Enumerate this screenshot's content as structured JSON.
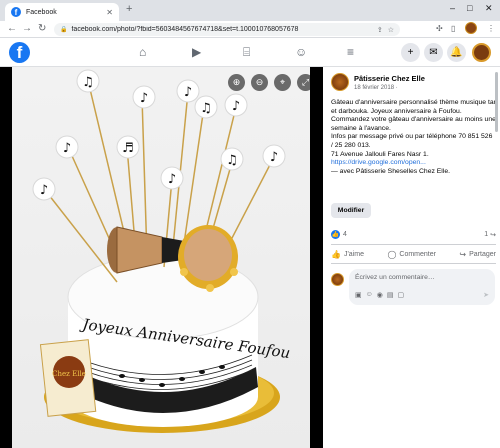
{
  "browser": {
    "tab_title": "Facebook",
    "tab_favicon": "f",
    "url": "facebook.com/photo/?fbid=5603484567674718&set=t.100010768057678"
  },
  "fb_header": {
    "logo": "f"
  },
  "post": {
    "page_name": "Pâtisserie Chez Elle",
    "date": "18 février 2018 ·",
    "text_lines": [
      "Gâteau d'anniversaire personnalisé thème musique tar et darbouka. Joyeux anniversaire à Foufou.",
      "Commandez votre gâteau d'anniversaire au moins une semaine à l'avance.",
      "Infos par message privé ou par téléphone 70 851 526 / 25 280 013.",
      "71 Avenue Jallouli Fares Nasr 1."
    ],
    "link": "https://drive.google.com/open...",
    "tagged": "— avec Pâtisserie Sheselles Chez Elle.",
    "edit_button": "Modifier",
    "like_count": "4",
    "share_count": "1"
  },
  "actions": {
    "like": "J'aime",
    "comment": "Commenter",
    "share": "Partager"
  },
  "comment": {
    "placeholder": "Écrivez un commentaire…"
  },
  "photo": {
    "cake_text": "Joyeux Anniversaire Foufou",
    "box_brand": "Chez Elle"
  },
  "colors": {
    "fb_blue": "#1877f2",
    "link": "#216fdb",
    "viewer_bg": "#000000"
  }
}
